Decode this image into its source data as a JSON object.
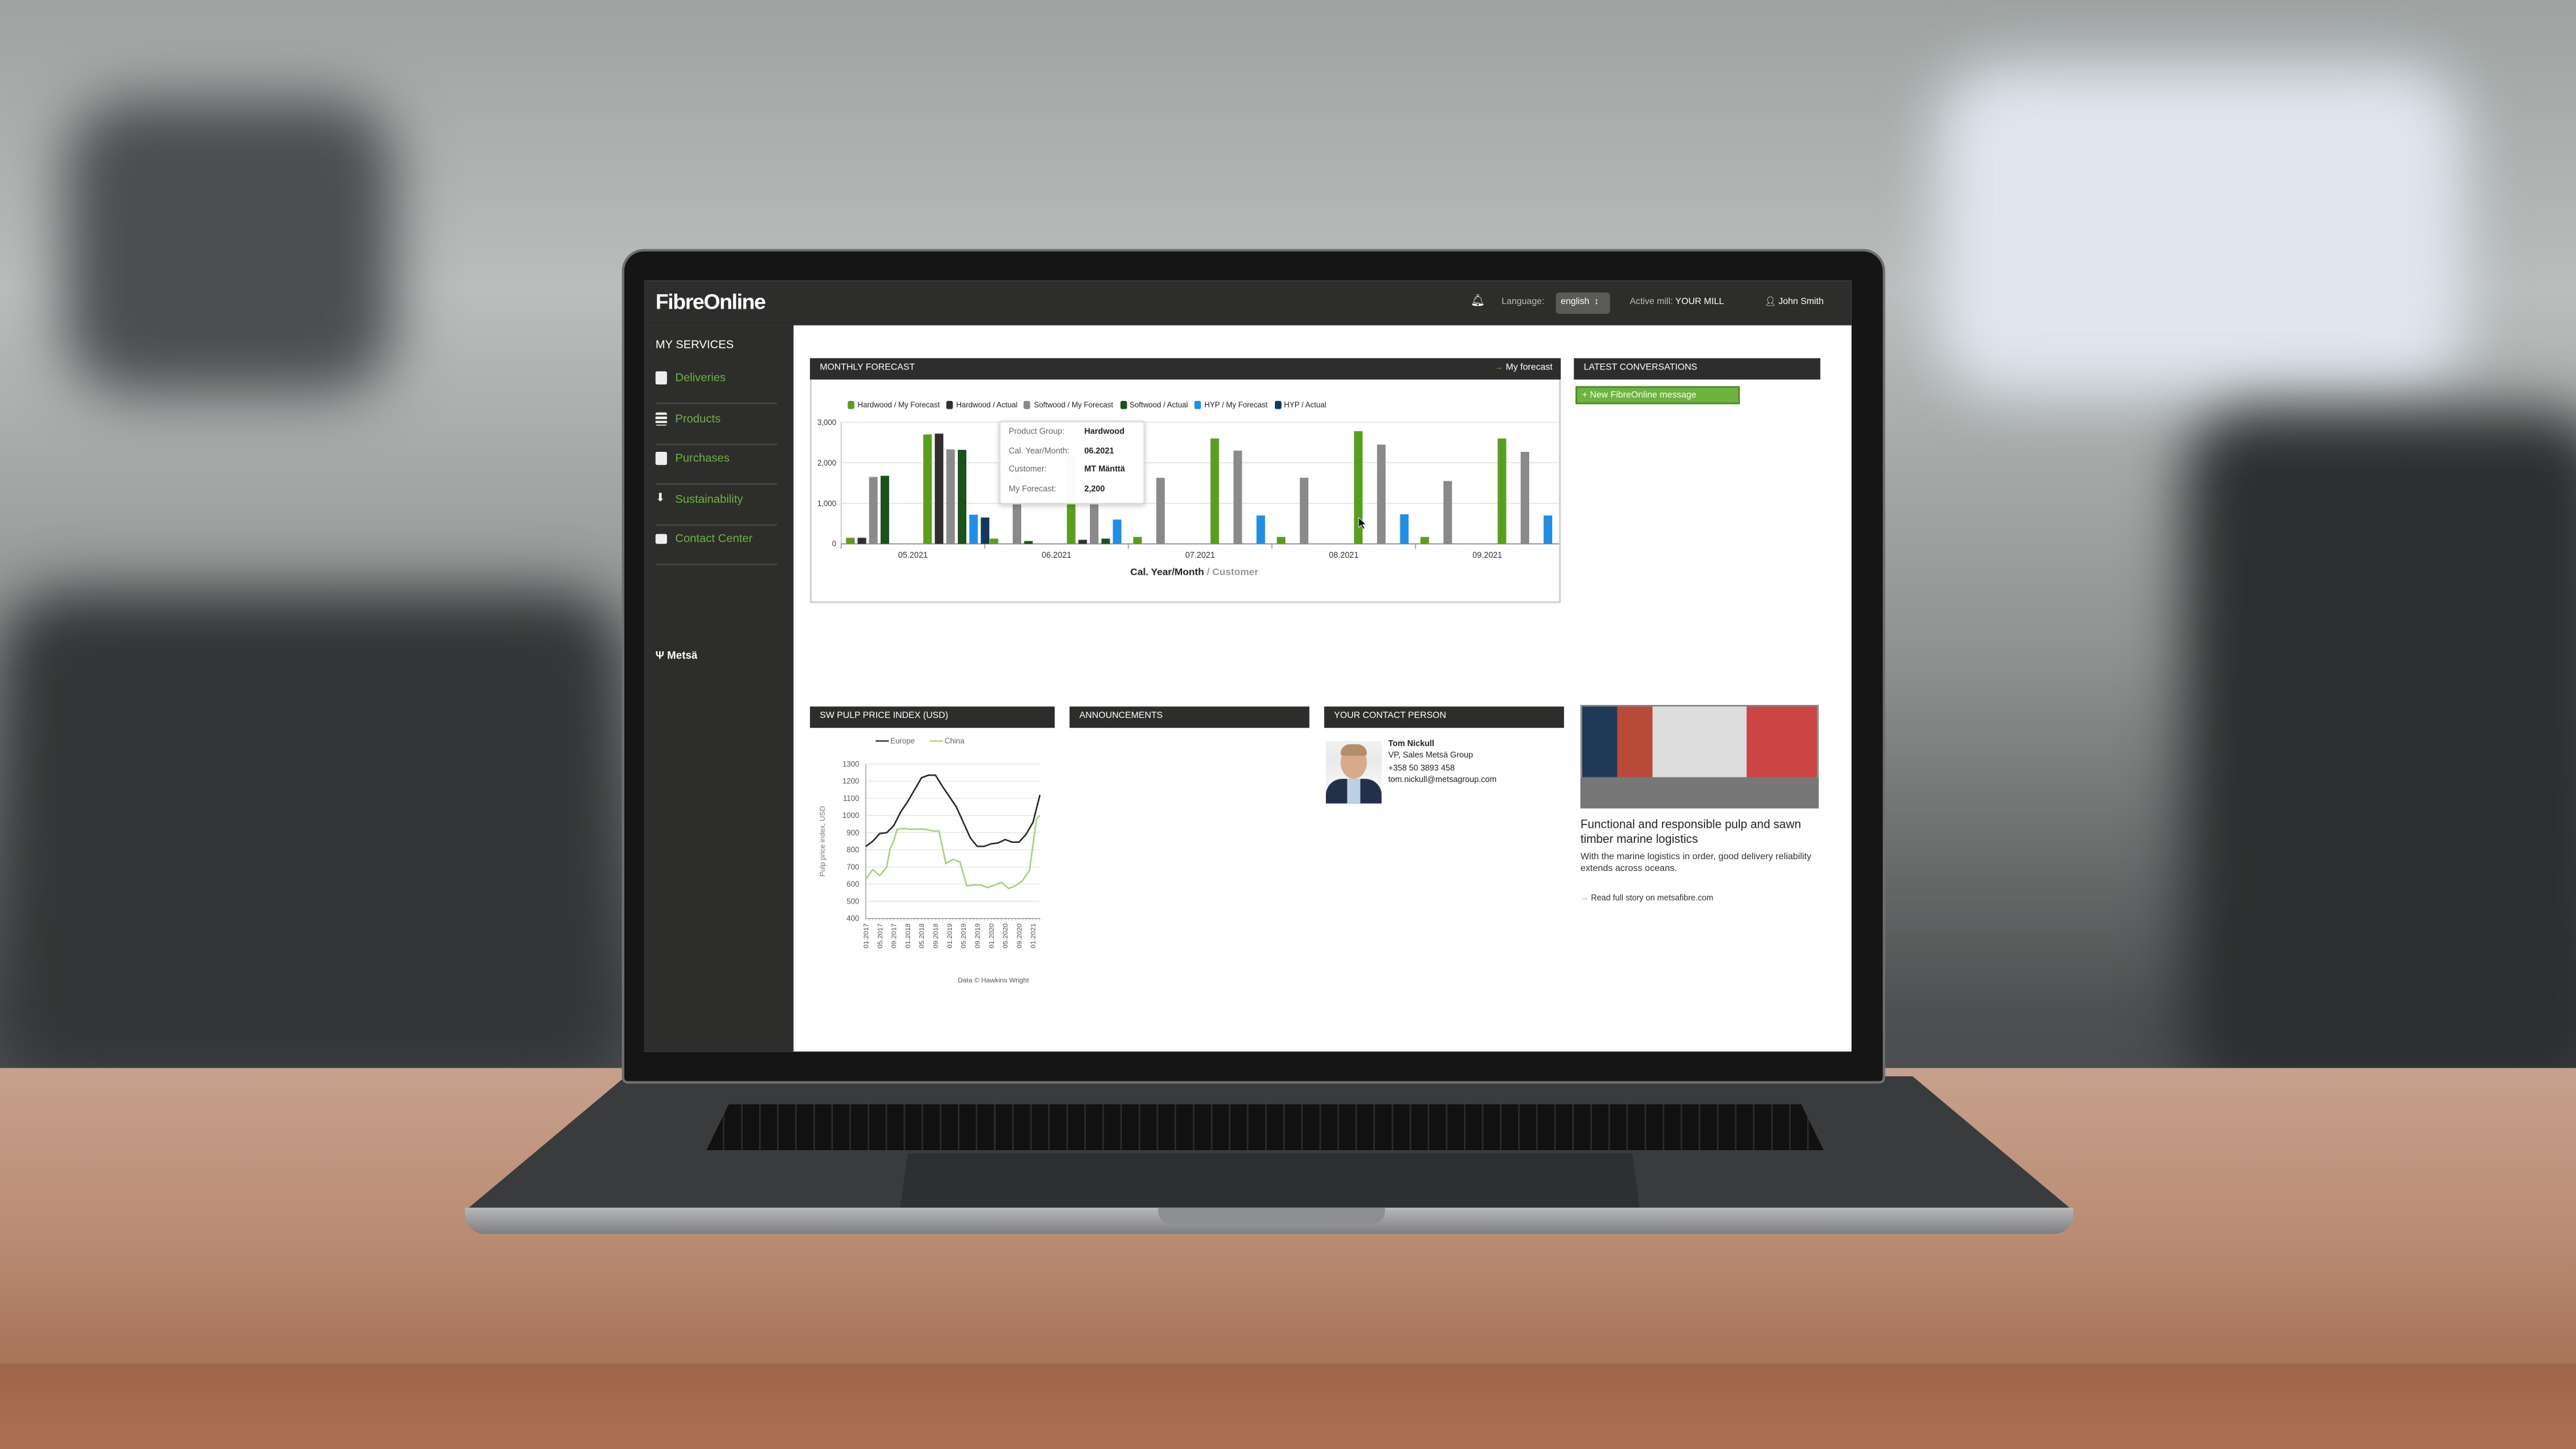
{
  "header": {
    "logo": "FibreOnline",
    "language_label": "Language:",
    "language_value": "english",
    "active_mill_label": "Active mill:",
    "active_mill_value": "YOUR MILL",
    "user": "John Smith"
  },
  "sidebar": {
    "title": "MY SERVICES",
    "items": [
      {
        "label": "Deliveries",
        "icon": "truck-doc-icon"
      },
      {
        "label": "Products",
        "icon": "list-icon"
      },
      {
        "label": "Purchases",
        "icon": "document-icon"
      },
      {
        "label": "Sustainability",
        "icon": "leaf-icon"
      },
      {
        "label": "Contact Center",
        "icon": "envelope-icon"
      }
    ],
    "brand": "Metsä"
  },
  "monthly_forecast": {
    "title": "MONTHLY FORECAST",
    "link": "My forecast",
    "axis_title": "Cal. Year/Month",
    "axis_title_secondary": "/ Customer",
    "tooltip": {
      "rows": [
        {
          "k": "Product Group:",
          "v": "Hardwood"
        },
        {
          "k": "Cal. Year/Month:",
          "v": "06.2021"
        },
        {
          "k": "Customer:",
          "v": "MT Mänttä"
        },
        {
          "k": "My Forecast:",
          "v": "2,200"
        }
      ]
    }
  },
  "latest_conversations": {
    "title": "LATEST CONVERSATIONS",
    "button": "New FibreOnline message"
  },
  "pulp": {
    "title": "SW PULP PRICE INDEX (USD)",
    "credit": "Data © Hawkins Wright"
  },
  "announcements": {
    "title": "ANNOUNCEMENTS"
  },
  "contact": {
    "title": "YOUR CONTACT PERSON",
    "name": "Tom Nickull",
    "role": "VP, Sales Metsä Group",
    "phone": "+358 50 3893 458",
    "email": "tom.nickull@metsagroup.com"
  },
  "article": {
    "title": "Functional and responsible pulp and sawn timber marine logistics",
    "text": "With the marine logistics in order, good delivery reliability extends across oceans.",
    "link": "Read full story on metsafibre.com"
  },
  "chart_data": [
    {
      "type": "bar",
      "title": "MONTHLY FORECAST",
      "xlabel": "Cal. Year/Month / Customer",
      "ylim": [
        0,
        3000
      ],
      "yticks": [
        "0",
        "1,000",
        "2,000",
        "3,000"
      ],
      "grid": true,
      "legend": "top",
      "categories": [
        "05.2021",
        "06.2021",
        "07.2021",
        "08.2021",
        "09.2021"
      ],
      "series": [
        {
          "name": "Hardwood / My Forecast",
          "color": "#5a9f1c"
        },
        {
          "name": "Hardwood / Actual",
          "color": "#2f2f2f"
        },
        {
          "name": "Softwood / My Forecast",
          "color": "#8a8a8a"
        },
        {
          "name": "Softwood / Actual",
          "color": "#1b5218"
        },
        {
          "name": "HYP / My Forecast",
          "color": "#1e8ee6"
        },
        {
          "name": "HYP / Actual",
          "color": "#0f3a5e"
        }
      ],
      "values": [
        [
          [
            150,
            150,
            1650,
            1680,
            null,
            null
          ],
          [
            2700,
            2720,
            2330,
            2320,
            720,
            650
          ]
        ],
        [
          [
            130,
            null,
            1650,
            70,
            null,
            null
          ],
          [
            2200,
            100,
            1600,
            130,
            600,
            null
          ]
        ],
        [
          [
            170,
            null,
            1630,
            null,
            null,
            null
          ],
          [
            2600,
            null,
            2300,
            null,
            700,
            null
          ]
        ],
        [
          [
            170,
            null,
            1630,
            null,
            null,
            null
          ],
          [
            2780,
            null,
            2450,
            null,
            730,
            null
          ]
        ],
        [
          [
            170,
            null,
            1550,
            null,
            null,
            null
          ],
          [
            2600,
            null,
            2270,
            null,
            700,
            null
          ]
        ]
      ]
    },
    {
      "type": "line",
      "title": "SW PULP PRICE INDEX (USD)",
      "ylabel": "Pulp price index, USD",
      "ylim": [
        400,
        1300
      ],
      "yticks": [
        400,
        500,
        600,
        700,
        800,
        900,
        1000,
        1100,
        1200,
        1300
      ],
      "grid": true,
      "legend": "top",
      "xticks": [
        "01.2017",
        "05.2017",
        "09.2017",
        "01.2018",
        "05.2018",
        "09.2018",
        "01.2019",
        "05.2019",
        "09.2019",
        "01.2020",
        "05.2020",
        "09.2020",
        "01.2021"
      ],
      "series": [
        {
          "name": "Europe",
          "color": "#222222",
          "points": [
            [
              "01.2017",
              820
            ],
            [
              "03.2017",
              850
            ],
            [
              "05.2017",
              895
            ],
            [
              "07.2017",
              900
            ],
            [
              "09.2017",
              940
            ],
            [
              "11.2017",
              1020
            ],
            [
              "01.2018",
              1080
            ],
            [
              "03.2018",
              1150
            ],
            [
              "05.2018",
              1220
            ],
            [
              "07.2018",
              1235
            ],
            [
              "09.2018",
              1235
            ],
            [
              "11.2018",
              1170
            ],
            [
              "01.2019",
              1110
            ],
            [
              "03.2019",
              1050
            ],
            [
              "05.2019",
              960
            ],
            [
              "07.2019",
              870
            ],
            [
              "09.2019",
              820
            ],
            [
              "11.2019",
              820
            ],
            [
              "01.2020",
              835
            ],
            [
              "03.2020",
              840
            ],
            [
              "05.2020",
              860
            ],
            [
              "07.2020",
              845
            ],
            [
              "09.2020",
              845
            ],
            [
              "11.2020",
              890
            ],
            [
              "01.2021",
              960
            ],
            [
              "03.2021",
              1120
            ]
          ]
        },
        {
          "name": "China",
          "color": "#a8cf7a",
          "points": [
            [
              "01.2017",
              630
            ],
            [
              "03.2017",
              685
            ],
            [
              "05.2017",
              650
            ],
            [
              "07.2017",
              700
            ],
            [
              "08.2017",
              810
            ],
            [
              "09.2017",
              850
            ],
            [
              "10.2017",
              920
            ],
            [
              "12.2017",
              925
            ],
            [
              "02.2018",
              920
            ],
            [
              "06.2018",
              920
            ],
            [
              "08.2018",
              910
            ],
            [
              "10.2018",
              910
            ],
            [
              "12.2018",
              720
            ],
            [
              "02.2019",
              745
            ],
            [
              "04.2019",
              730
            ],
            [
              "06.2019",
              590
            ],
            [
              "08.2019",
              595
            ],
            [
              "10.2019",
              595
            ],
            [
              "12.2019",
              580
            ],
            [
              "02.2020",
              595
            ],
            [
              "04.2020",
              610
            ],
            [
              "06.2020",
              575
            ],
            [
              "08.2020",
              590
            ],
            [
              "10.2020",
              620
            ],
            [
              "12.2020",
              680
            ],
            [
              "02.2021",
              980
            ],
            [
              "03.2021",
              1000
            ]
          ]
        }
      ]
    }
  ]
}
